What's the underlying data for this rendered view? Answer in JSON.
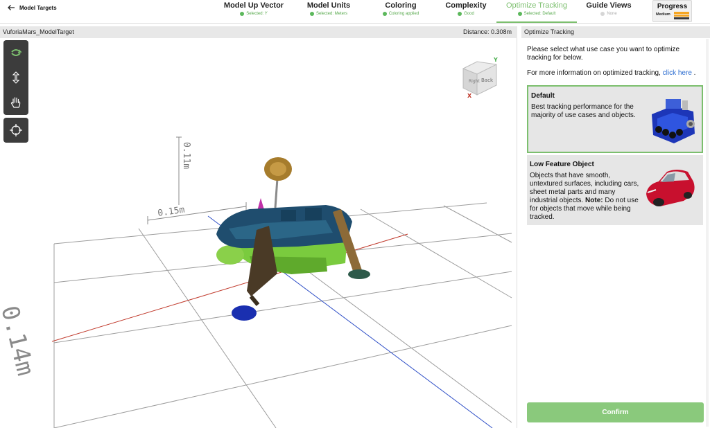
{
  "header": {
    "back_label": "Model Targets",
    "steps": [
      {
        "title": "Model Up Vector",
        "status": "Selected: Y",
        "state": "done"
      },
      {
        "title": "Model Units",
        "status": "Selected: Meters",
        "state": "done"
      },
      {
        "title": "Coloring",
        "status": "Coloring applied",
        "state": "done"
      },
      {
        "title": "Complexity",
        "status": "Good",
        "state": "done"
      },
      {
        "title": "Optimize Tracking",
        "status": "Selected: Default",
        "state": "active"
      },
      {
        "title": "Guide Views",
        "status": "None",
        "state": "inactive"
      }
    ],
    "progress": {
      "title": "Progress",
      "level": "Medium"
    }
  },
  "viewport": {
    "model_name": "VuforiaMars_ModelTarget",
    "distance": "Distance:  0.308m",
    "ruler_labels": {
      "vertical": "0.11m",
      "horizontal": "0.15m",
      "depth": "0.14m"
    },
    "view_cube": {
      "face_right": "Back",
      "face_left": "Right",
      "axis_y": "Y",
      "axis_x": "X"
    },
    "tools": [
      "rotate-icon",
      "move-vertical-icon",
      "pan-hand-icon",
      "recenter-icon"
    ]
  },
  "panel": {
    "header": "Optimize Tracking",
    "intro": "Please select what use case you want to optimize tracking for below.",
    "more_prefix": "For more information on optimized tracking, ",
    "more_link": "click here",
    "more_suffix": " .",
    "options": [
      {
        "title": "Default",
        "description": "Best tracking performance for the majority of use cases and objects.",
        "selected": true
      },
      {
        "title": "Low Feature Object",
        "description": "Objects that have smooth, untextured surfaces, including cars, sheet metal parts and many industrial objects.",
        "note_label": "Note:",
        "note_text": " Do not use for objects that move while being tracked.",
        "selected": false
      }
    ],
    "confirm": "Confirm"
  },
  "colors": {
    "accent_green": "#7cbf6e",
    "status_green": "#5cb85c",
    "link_blue": "#2b6cd0",
    "progress_orange": "#f5a623"
  }
}
